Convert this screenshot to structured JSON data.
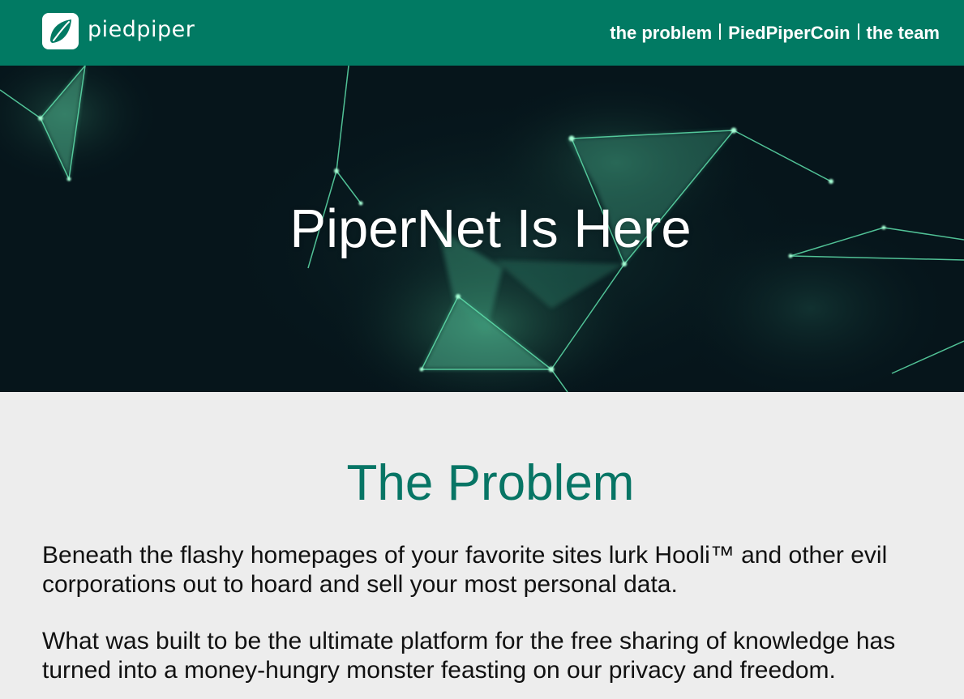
{
  "header": {
    "brand": "piedpiper",
    "logo_icon": "leaf-icon",
    "nav": [
      {
        "label": "the problem"
      },
      {
        "label": "PiedPiperCoin"
      },
      {
        "label": "the team"
      }
    ],
    "colors": {
      "brand_green": "#017a63"
    }
  },
  "hero": {
    "title": "PiperNet Is Here"
  },
  "problem": {
    "title": "The Problem",
    "paragraphs": [
      "Beneath the flashy homepages of your favorite sites lurk Hooli™ and other evil corporations out to hoard and sell your most personal data.",
      "What was built to be the ultimate platform for the free sharing of knowledge has turned into a money-hungry monster feasting on our privacy and freedom."
    ],
    "colors": {
      "title": "#077565"
    }
  }
}
